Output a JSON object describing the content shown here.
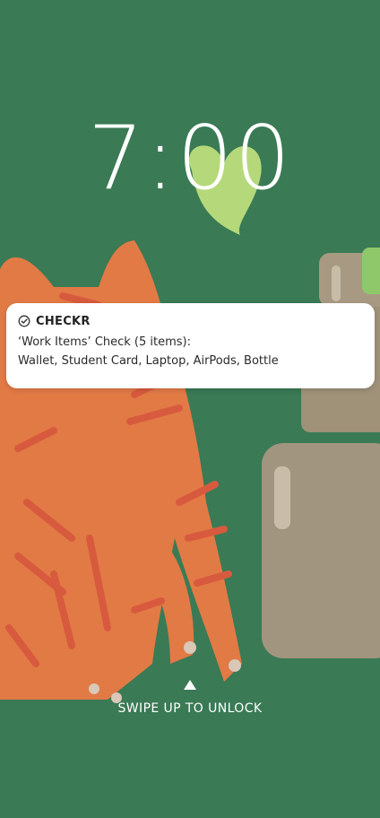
{
  "lock_screen": {
    "time": "7:00",
    "background_color": "#3a7a55",
    "unlock_hint": "SWIPE UP TO UNLOCK"
  },
  "notification": {
    "app_name": "CHECKR",
    "app_icon": "check-circle-icon",
    "title": "‘Work Items’ Check (5 items):",
    "body": "Wallet, Student Card, Laptop, AirPods, Bottle"
  }
}
